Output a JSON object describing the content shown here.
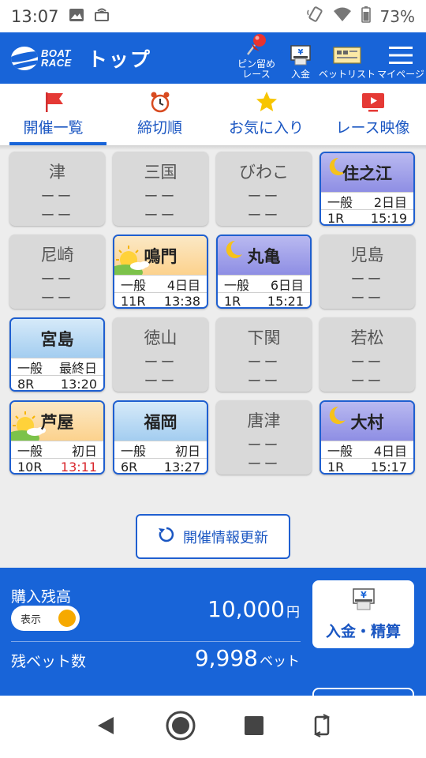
{
  "status_bar": {
    "time": "13:07",
    "battery": "73%"
  },
  "header": {
    "logo_line1": "BOAT",
    "logo_line2": "RACE",
    "title": "トップ",
    "buttons": [
      {
        "name": "pin-race",
        "label_line1": "ピン留め",
        "label_line2": "レース",
        "icon": "pushpin-icon"
      },
      {
        "name": "deposit",
        "label_line1": "入金",
        "label_line2": "",
        "icon": "yen-atm-icon"
      },
      {
        "name": "bet-list",
        "label_line1": "ベットリスト",
        "label_line2": "",
        "icon": "ticket-icon"
      },
      {
        "name": "my-page",
        "label_line1": "マイページ",
        "label_line2": "",
        "icon": "hamburger-icon"
      }
    ]
  },
  "tabs": [
    {
      "label": "開催一覧",
      "icon": "flag-icon",
      "active": true
    },
    {
      "label": "締切順",
      "icon": "alarm-clock-icon",
      "active": false
    },
    {
      "label": "お気に入り",
      "icon": "star-icon",
      "active": false
    },
    {
      "label": "レース映像",
      "icon": "video-icon",
      "active": false
    }
  ],
  "venues": [
    {
      "name": "津",
      "open": false,
      "dash1": "ーー",
      "dash2": "ーー"
    },
    {
      "name": "三国",
      "open": false,
      "dash1": "ーー",
      "dash2": "ーー"
    },
    {
      "name": "びわこ",
      "open": false,
      "dash1": "ーー",
      "dash2": "ーー"
    },
    {
      "name": "住之江",
      "open": true,
      "bg": "night",
      "grade": "一般",
      "day": "2日目",
      "race": "1R",
      "time": "15:19",
      "time_color": "#222222"
    },
    {
      "name": "尼崎",
      "open": false,
      "dash1": "ーー",
      "dash2": "ーー"
    },
    {
      "name": "鳴門",
      "open": true,
      "bg": "sunrise",
      "grade": "一般",
      "day": "4日目",
      "race": "11R",
      "time": "13:38",
      "time_color": "#222222"
    },
    {
      "name": "丸亀",
      "open": true,
      "bg": "night",
      "grade": "一般",
      "day": "6日目",
      "race": "1R",
      "time": "15:21",
      "time_color": "#222222"
    },
    {
      "name": "児島",
      "open": false,
      "dash1": "ーー",
      "dash2": "ーー"
    },
    {
      "name": "宮島",
      "open": true,
      "bg": "day",
      "grade": "一般",
      "day": "最終日",
      "race": "8R",
      "time": "13:20",
      "time_color": "#222222"
    },
    {
      "name": "徳山",
      "open": false,
      "dash1": "ーー",
      "dash2": "ーー"
    },
    {
      "name": "下関",
      "open": false,
      "dash1": "ーー",
      "dash2": "ーー"
    },
    {
      "name": "若松",
      "open": false,
      "dash1": "ーー",
      "dash2": "ーー"
    },
    {
      "name": "芦屋",
      "open": true,
      "bg": "sunrise",
      "grade": "一般",
      "day": "初日",
      "race": "10R",
      "time": "13:11",
      "time_color": "#d9262c"
    },
    {
      "name": "福岡",
      "open": true,
      "bg": "day",
      "grade": "一般",
      "day": "初日",
      "race": "6R",
      "time": "13:27",
      "time_color": "#222222"
    },
    {
      "name": "唐津",
      "open": false,
      "dash1": "ーー",
      "dash2": "ーー"
    },
    {
      "name": "大村",
      "open": true,
      "bg": "night",
      "grade": "一般",
      "day": "4日目",
      "race": "1R",
      "time": "15:17",
      "time_color": "#222222"
    }
  ],
  "refresh": {
    "label": "開催情報更新"
  },
  "balance": {
    "label": "購入残高",
    "toggle_label": "表示",
    "amount": "10,000",
    "amount_unit": "円",
    "bets_label": "残ベット数",
    "bets_count": "9,998",
    "bets_unit": "ベット",
    "deposit_label": "入金・精算"
  }
}
